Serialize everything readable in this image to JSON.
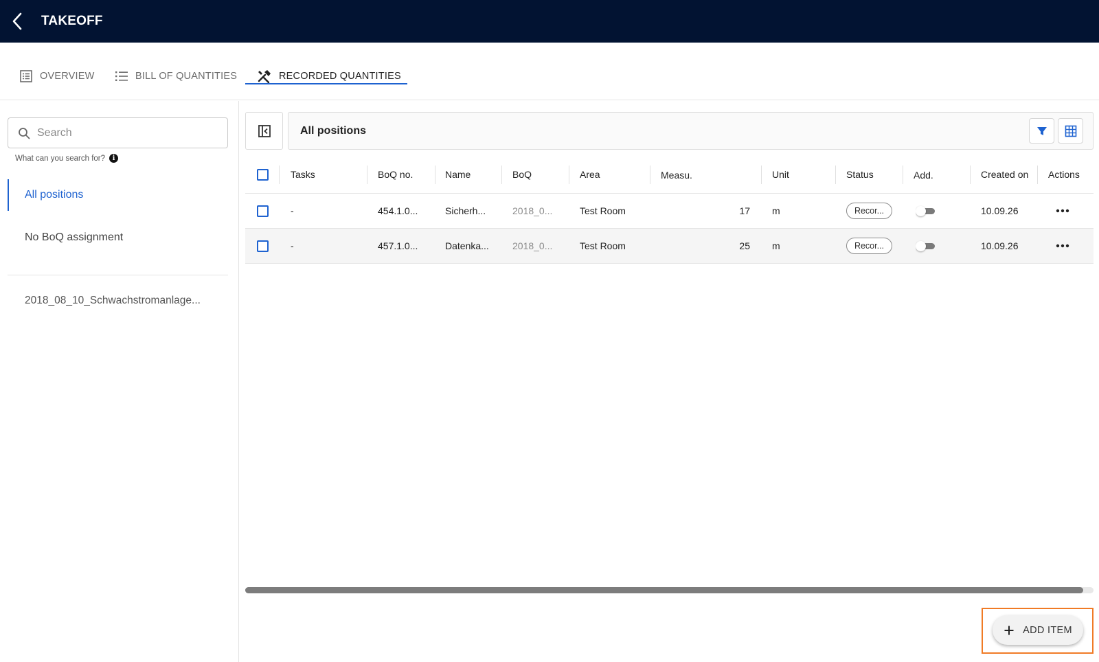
{
  "app": {
    "title": "TAKEOFF"
  },
  "tabs": [
    {
      "label": "OVERVIEW",
      "icon": "list-box-icon"
    },
    {
      "label": "BILL OF QUANTITIES",
      "icon": "bulleted-list-icon"
    },
    {
      "label": "RECORDED QUANTITIES",
      "icon": "tools-icon",
      "active": true
    }
  ],
  "sidebar": {
    "search_placeholder": "Search",
    "search_hint": "What can you search for?",
    "items": [
      {
        "label": "All positions",
        "active": true
      },
      {
        "label": "No BoQ assignment"
      },
      {
        "label": "2018_08_10_Schwachstromanlage..."
      }
    ]
  },
  "header": {
    "title": "All positions"
  },
  "table": {
    "columns": [
      "Tasks",
      "BoQ no.",
      "Name",
      "BoQ",
      "Area",
      "Measu.",
      "Unit",
      "Status",
      "Add.",
      "Created on",
      "Actions"
    ],
    "rows": [
      {
        "tasks": "-",
        "boq_no": "454.1.0...",
        "name": "Sicherh...",
        "boq": "2018_0...",
        "area": "Test Room",
        "measure": "17",
        "unit": "m",
        "status": "Recor...",
        "created_on": "10.09.26"
      },
      {
        "tasks": "-",
        "boq_no": "457.1.0...",
        "name": "Datenka...",
        "boq": "2018_0...",
        "area": "Test Room",
        "measure": "25",
        "unit": "m",
        "status": "Recor...",
        "created_on": "10.09.26"
      }
    ]
  },
  "fab": {
    "label": "ADD ITEM"
  },
  "colors": {
    "topbar": "#021332",
    "accent": "#1e62d0",
    "highlight": "#f07b26"
  }
}
